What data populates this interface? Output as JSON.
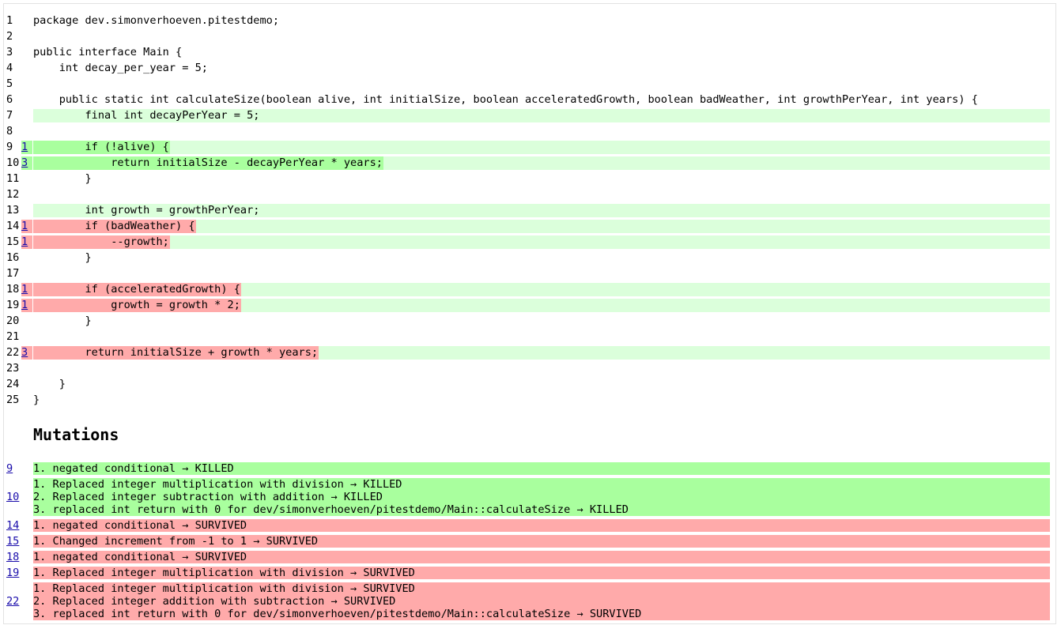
{
  "code_lines": [
    {
      "n": "1",
      "text": "package dev.simonverhoeven.pitestdemo;",
      "status": "none",
      "mut": ""
    },
    {
      "n": "2",
      "text": "",
      "status": "none",
      "mut": ""
    },
    {
      "n": "3",
      "text": "public interface Main {",
      "status": "none",
      "mut": ""
    },
    {
      "n": "4",
      "text": "    int decay_per_year = 5;",
      "status": "none",
      "mut": ""
    },
    {
      "n": "5",
      "text": "",
      "status": "none",
      "mut": ""
    },
    {
      "n": "6",
      "text": "    public static int calculateSize(boolean alive, int initialSize, boolean acceleratedGrowth, boolean badWeather, int growthPerYear, int years) {",
      "status": "none",
      "mut": ""
    },
    {
      "n": "7",
      "text": "        final int decayPerYear = 5;",
      "status": "covered",
      "mut": ""
    },
    {
      "n": "8",
      "text": "",
      "status": "none",
      "mut": ""
    },
    {
      "n": "9",
      "text": "        if (!alive) {",
      "status": "killed",
      "mut": "1"
    },
    {
      "n": "10",
      "text": "            return initialSize - decayPerYear * years;",
      "status": "killed",
      "mut": "3"
    },
    {
      "n": "11",
      "text": "        }",
      "status": "none",
      "mut": ""
    },
    {
      "n": "12",
      "text": "",
      "status": "none",
      "mut": ""
    },
    {
      "n": "13",
      "text": "        int growth = growthPerYear;",
      "status": "covered",
      "mut": ""
    },
    {
      "n": "14",
      "text": "        if (badWeather) {",
      "status": "survived",
      "mut": "1"
    },
    {
      "n": "15",
      "text": "            --growth;",
      "status": "survived",
      "mut": "1"
    },
    {
      "n": "16",
      "text": "        }",
      "status": "none",
      "mut": ""
    },
    {
      "n": "17",
      "text": "",
      "status": "none",
      "mut": ""
    },
    {
      "n": "18",
      "text": "        if (acceleratedGrowth) {",
      "status": "survived",
      "mut": "1"
    },
    {
      "n": "19",
      "text": "            growth = growth * 2;",
      "status": "survived",
      "mut": "1"
    },
    {
      "n": "20",
      "text": "        }",
      "status": "none",
      "mut": ""
    },
    {
      "n": "21",
      "text": "",
      "status": "none",
      "mut": ""
    },
    {
      "n": "22",
      "text": "        return initialSize + growth * years;",
      "status": "survived",
      "mut": "3"
    },
    {
      "n": "23",
      "text": "",
      "status": "none",
      "mut": ""
    },
    {
      "n": "24",
      "text": "    }",
      "status": "none",
      "mut": ""
    },
    {
      "n": "25",
      "text": "}",
      "status": "none",
      "mut": ""
    }
  ],
  "mutations_title": "Mutations",
  "mutations": [
    {
      "line": "9",
      "status": "killed",
      "items": [
        "1. negated conditional → KILLED"
      ]
    },
    {
      "line": "10",
      "status": "killed",
      "items": [
        "1. Replaced integer multiplication with division → KILLED",
        "2. Replaced integer subtraction with addition → KILLED",
        "3. replaced int return with 0 for dev/simonverhoeven/pitestdemo/Main::calculateSize → KILLED"
      ]
    },
    {
      "line": "14",
      "status": "survived",
      "items": [
        "1. negated conditional → SURVIVED"
      ]
    },
    {
      "line": "15",
      "status": "survived",
      "items": [
        "1. Changed increment from -1 to 1 → SURVIVED"
      ]
    },
    {
      "line": "18",
      "status": "survived",
      "items": [
        "1. negated conditional → SURVIVED"
      ]
    },
    {
      "line": "19",
      "status": "survived",
      "items": [
        "1. Replaced integer multiplication with division → SURVIVED"
      ]
    },
    {
      "line": "22",
      "status": "survived",
      "items": [
        "1. Replaced integer multiplication with division → SURVIVED",
        "2. Replaced integer addition with subtraction → SURVIVED",
        "3. replaced int return with 0 for dev/simonverhoeven/pitestdemo/Main::calculateSize → SURVIVED"
      ]
    }
  ],
  "colors": {
    "covered_bg": "#dbffdb",
    "killed_bg": "#a9ff9e",
    "survived_bg": "#ffaaaa",
    "link": "#1a0dab"
  }
}
